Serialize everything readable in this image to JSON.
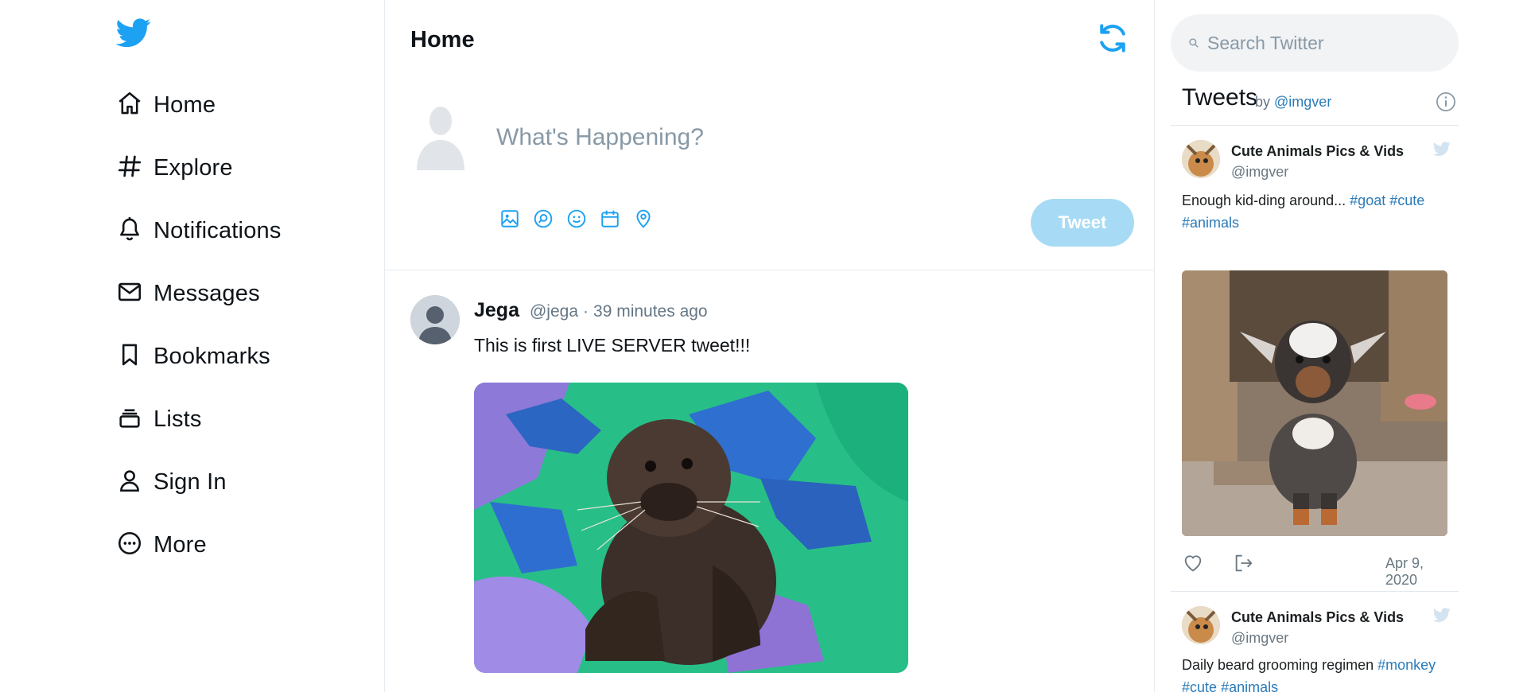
{
  "colors": {
    "brand_blue": "#1da1f2",
    "tweet_button_disabled": "#a7dbf5",
    "link_blue": "#2b7bb9",
    "muted_text": "#657786",
    "border": "#e6ecf0"
  },
  "sidebar": {
    "logo_icon": "twitter-bird-icon",
    "items": [
      {
        "label": "Home",
        "icon": "home-icon"
      },
      {
        "label": "Explore",
        "icon": "hashtag-icon"
      },
      {
        "label": "Notifications",
        "icon": "bell-icon"
      },
      {
        "label": "Messages",
        "icon": "envelope-icon"
      },
      {
        "label": "Bookmarks",
        "icon": "bookmark-icon"
      },
      {
        "label": "Lists",
        "icon": "list-icon"
      },
      {
        "label": "Sign In",
        "icon": "user-icon"
      },
      {
        "label": "More",
        "icon": "more-icon"
      }
    ]
  },
  "main": {
    "title": "Home",
    "refresh_icon": "refresh-icon",
    "composer": {
      "placeholder": "What's Happening?",
      "tools": [
        "image-icon",
        "gif-icon",
        "emoji-icon",
        "schedule-icon",
        "location-icon"
      ],
      "tweet_button": "Tweet"
    },
    "tweet": {
      "name": "Jega",
      "handle": "@jega",
      "separator": "·",
      "time": "39 minutes ago",
      "text": "This is first LIVE SERVER tweet!!!",
      "media": "sea-otter-pup-photo"
    }
  },
  "right": {
    "search_placeholder": "Search Twitter",
    "widget": {
      "title": "Tweets",
      "by_prefix": "by",
      "by_handle": "@imgver"
    },
    "embeds": [
      {
        "name": "Cute Animals Pics & Vids",
        "handle": "@imgver",
        "text": "Enough kid-ding around...",
        "tags": [
          "#goat",
          "#cute",
          "#animals"
        ],
        "media": "baby-goat-photo",
        "date": "Apr 9, 2020"
      },
      {
        "name": "Cute Animals Pics & Vids",
        "handle": "@imgver",
        "text": "Daily beard grooming regimen",
        "tags": [
          "#monkey",
          "#cute",
          "#animals"
        ]
      }
    ]
  }
}
